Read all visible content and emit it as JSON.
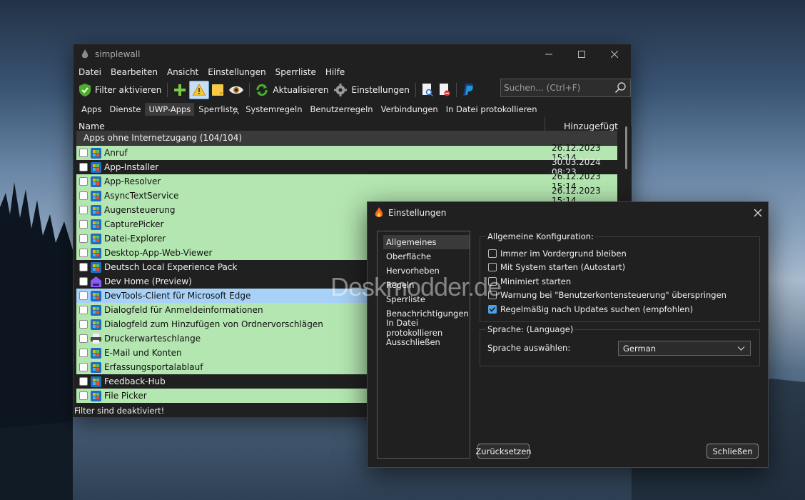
{
  "main": {
    "title": "simplewall",
    "menu": [
      "Datei",
      "Bearbeiten",
      "Ansicht",
      "Einstellungen",
      "Sperrliste",
      "Hilfe"
    ],
    "toolbar": {
      "filter_label": "Filter aktivieren",
      "refresh_label": "Aktualisieren",
      "settings_label": "Einstellungen"
    },
    "search_placeholder": "Suchen... (Ctrl+F)",
    "tabs": [
      "Apps",
      "Dienste",
      "UWP-Apps",
      "Sperrliste",
      "Systemregeln",
      "Benutzerregeln",
      "Verbindungen",
      "In Datei protokollieren"
    ],
    "selected_tab": "UWP-Apps",
    "columns": {
      "name": "Name",
      "added": "Hinzugefügt"
    },
    "group_label": "Apps ohne Internetzugang (104/104)",
    "rows": [
      {
        "name": "Anruf",
        "date": "26.12.2023 15:14",
        "color": "green",
        "icon": "uwp-app-icon"
      },
      {
        "name": "App-Installer",
        "date": "30.03.2024 08:23",
        "color": "dark",
        "icon": "uwp-app-icon"
      },
      {
        "name": "App-Resolver",
        "date": "26.12.2023 15:14",
        "color": "green",
        "icon": "uwp-app-icon"
      },
      {
        "name": "AsyncTextService",
        "date": "26.12.2023 15:14",
        "color": "green",
        "icon": "uwp-app-icon"
      },
      {
        "name": "Augensteuerung",
        "date": "",
        "color": "green",
        "icon": "uwp-app-icon"
      },
      {
        "name": "CapturePicker",
        "date": "",
        "color": "green",
        "icon": "uwp-app-icon"
      },
      {
        "name": "Datei-Explorer",
        "date": "",
        "color": "green",
        "icon": "uwp-app-icon"
      },
      {
        "name": "Desktop-App-Web-Viewer",
        "date": "",
        "color": "green",
        "icon": "uwp-app-icon"
      },
      {
        "name": "Deutsch Local Experience Pack",
        "date": "",
        "color": "dark",
        "icon": "uwp-app-icon"
      },
      {
        "name": "Dev Home (Preview)",
        "date": "",
        "color": "dark",
        "icon": "dev-home-icon"
      },
      {
        "name": "DevTools-Client für Microsoft Edge",
        "date": "",
        "color": "blue",
        "icon": "uwp-app-icon"
      },
      {
        "name": "Dialogfeld für Anmeldeinformationen",
        "date": "",
        "color": "green",
        "icon": "uwp-app-icon"
      },
      {
        "name": "Dialogfeld zum Hinzufügen von Ordnervorschlägen",
        "date": "",
        "color": "green",
        "icon": "uwp-app-icon"
      },
      {
        "name": "Druckerwarteschlange",
        "date": "",
        "color": "green",
        "icon": "printer-icon"
      },
      {
        "name": "E-Mail und Konten",
        "date": "",
        "color": "green",
        "icon": "uwp-app-icon"
      },
      {
        "name": "Erfassungsportalablauf",
        "date": "",
        "color": "green",
        "icon": "uwp-app-icon"
      },
      {
        "name": "Feedback-Hub",
        "date": "",
        "color": "dark",
        "icon": "uwp-app-icon"
      },
      {
        "name": "File Picker",
        "date": "",
        "color": "green",
        "icon": "uwp-app-icon"
      }
    ],
    "status": "Filter sind deaktiviert!"
  },
  "dialog": {
    "title": "Einstellungen",
    "nav": [
      "Allgemeines",
      "Oberfläche",
      "Hervorheben",
      "Regeln",
      "Sperrliste",
      "Benachrichtigungen",
      "In Datei protokollieren",
      "Ausschließen"
    ],
    "nav_selected": "Allgemeines",
    "general_group_title": "Allgemeine Konfiguration:",
    "options": [
      {
        "label": "Immer im Vordergrund bleiben",
        "checked": false
      },
      {
        "label": "Mit System starten (Autostart)",
        "checked": false
      },
      {
        "label": "Minimiert starten",
        "checked": false
      },
      {
        "label": "Warnung bei \"Benutzerkontensteuerung\" überspringen",
        "checked": false
      },
      {
        "label": "Regelmäßig nach Updates suchen (empfohlen)",
        "checked": true
      }
    ],
    "language_group_title": "Sprache: (Language)",
    "language_label": "Sprache auswählen:",
    "language_value": "German",
    "reset_label": "Zurücksetzen",
    "close_label": "Schließen"
  },
  "watermark": "Deskmodder.de",
  "colors": {
    "row_green": "#b3e6b0",
    "row_blue": "#a8d1f7",
    "window_bg": "#202020",
    "accent": "#4e9fe6"
  }
}
